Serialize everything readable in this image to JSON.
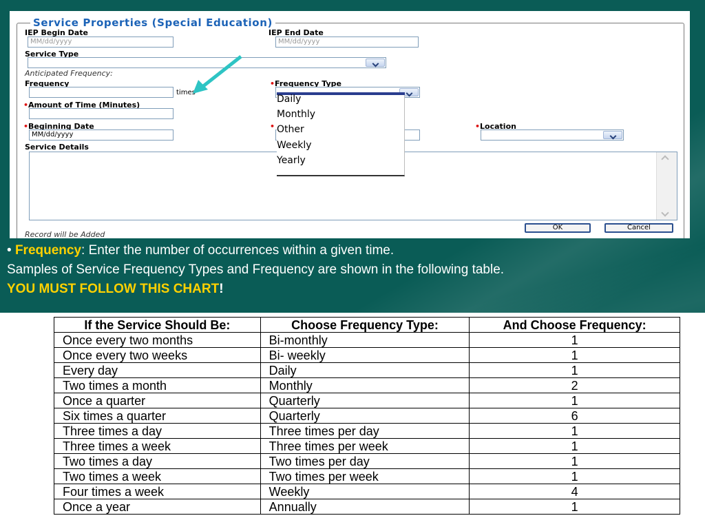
{
  "form": {
    "legend": "Service Properties (Special Education)",
    "iep_begin_label": "IEP Begin Date",
    "iep_begin_placeholder": "MM/dd/yyyy",
    "iep_end_label": "IEP End Date",
    "iep_end_placeholder": "MM/dd/yyyy",
    "service_type_label": "Service Type",
    "anticipated_label": "Anticipated Frequency:",
    "frequency_label": "Frequency",
    "times_label": "times",
    "frequency_type_label": "Frequency Type",
    "amount_label": "Amount of Time (Minutes)",
    "beginning_date_label": "Beginning Date",
    "beginning_date_value": "MM/dd/yyyy",
    "location_label": "Location",
    "service_details_label": "Service Details",
    "record_status": "Record will be Added",
    "ok_label": "OK",
    "cancel_label": "Cancel",
    "dropdown_options": [
      "Daily",
      "Monthly",
      "Other",
      "Weekly",
      "Yearly"
    ]
  },
  "text": {
    "bullet": "•",
    "term": "Frequency",
    "definition": ": Enter the number of occurrences within a given time.",
    "line2": "Samples of Service Frequency Types and Frequency are shown in the following table.",
    "warning": "YOU MUST FOLLOW THIS CHART",
    "warning_bang": "!"
  },
  "table": {
    "headers": [
      "If the Service Should Be:",
      "Choose Frequency Type:",
      "And Choose Frequency:"
    ],
    "rows": [
      [
        "Once every two months",
        "Bi-monthly",
        "1"
      ],
      [
        "Once every two weeks",
        "Bi- weekly",
        "1"
      ],
      [
        "Every day",
        "Daily",
        "1"
      ],
      [
        "Two times a month",
        "Monthly",
        "2"
      ],
      [
        "Once a quarter",
        "Quarterly",
        "1"
      ],
      [
        "Six times a quarter",
        "Quarterly",
        "6"
      ],
      [
        "Three times a day",
        "Three times per day",
        "1"
      ],
      [
        "Three times a week",
        "Three times per week",
        "1"
      ],
      [
        "Two times a day",
        "Two times per day",
        "1"
      ],
      [
        "Two times a week",
        "Two times per week",
        "1"
      ],
      [
        "Four times a week",
        "Weekly",
        "4"
      ],
      [
        "Once a year",
        "Annually",
        "1"
      ]
    ]
  },
  "colors": {
    "background": "#0a5c56",
    "legend": "#1c63b7",
    "highlight": "#ffd100",
    "arrow": "#2ec4c4",
    "required": "#d11111"
  },
  "icons": {
    "arrow": "diagonal-arrow-icon",
    "dropdown": "chevron-down-icon",
    "required": "required-dot-icon"
  }
}
